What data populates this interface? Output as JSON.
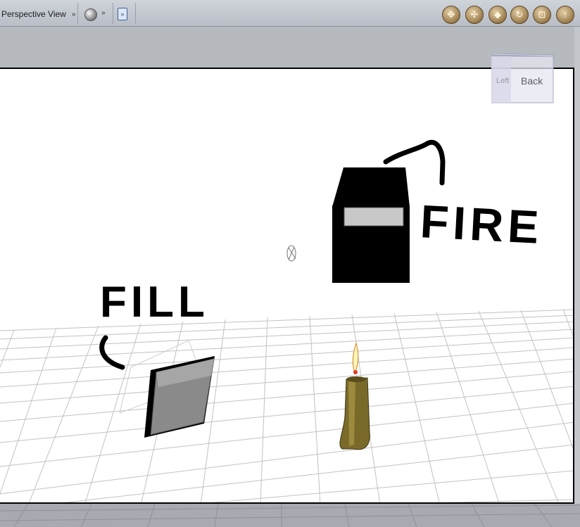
{
  "toolbar": {
    "view_label": "Perspective View",
    "view_chevron": "»",
    "display_chevron": "»",
    "nav_buttons": [
      {
        "icon": "rotate-icon",
        "glyph": "✥"
      },
      {
        "icon": "translate-icon",
        "glyph": "✢"
      },
      {
        "icon": "dolly-icon",
        "glyph": "◆"
      },
      {
        "icon": "orbit-icon",
        "glyph": "↻"
      },
      {
        "icon": "frame-icon",
        "glyph": "⊡"
      },
      {
        "icon": "up-arrow-icon",
        "glyph": "↑"
      }
    ]
  },
  "viewport": {
    "cube_face_label": "Back",
    "annotations": {
      "fire": "FIRE",
      "fill": "FILL"
    }
  },
  "colors": {
    "floor_line": "#bdbdbd",
    "annotation_ink": "#000000",
    "candle": "#7a6a2a"
  }
}
